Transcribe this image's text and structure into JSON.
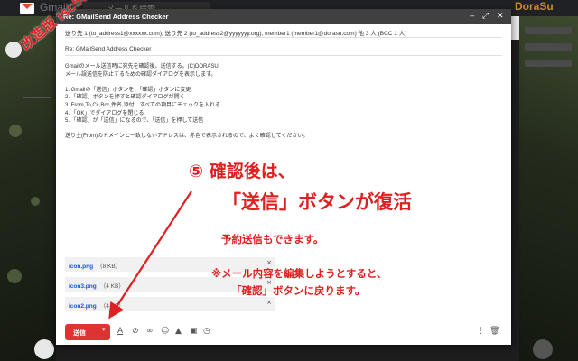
{
  "gmail": {
    "logo_text": "Gmail",
    "search_text": "メールを検索",
    "brand": "DoraSu"
  },
  "window": {
    "title": "Re: GMailSend Address Checker"
  },
  "fields": {
    "to": "送り先 1 (to_address1@xxxxxx.com), 送り先 2 (to_address2@yyyyyyy.org), member1 (member1@dorasu.com) 他 3 人 (BCC 1 人)",
    "subject": "Re: GMailSend Address Checker"
  },
  "body": [
    "Gmailのメール送信時に宛先を確認後、送信する。(C)DORASU",
    "メール誤送信を防止するための確認ダイアログを表示します。",
    "",
    "1. Gmailの「送信」ボタンを、「確認」ボタンに変更",
    "2. 「確認」ボタンを押すと確認ダイアログが開く",
    "3. From,To,Cc,Bcc,件名,添付、すべての項目にチェックを入れる",
    "4. 「OK」でダイアログを閉じる",
    "5. 「確認」が「送信」になるので、「送信」を押して送信",
    "",
    "送り主(From)のドメインと一致しないアドレスは、赤色で表示されるので、よく確認してください。"
  ],
  "attachments": [
    {
      "name": "icon.png",
      "size": "（8 KB）"
    },
    {
      "name": "icon3.png",
      "size": "（4 KB）"
    },
    {
      "name": "icon2.png",
      "size": "（4 KB）"
    }
  ],
  "toolbar": {
    "send_label": "送信"
  },
  "overlay": {
    "watermark": "改造版 tsc566",
    "heading_line1": "⑤ 確認後は、",
    "heading_line2": "「送信」ボタンが復活",
    "subtext": "予約送信もできます。",
    "note_line1": "※メール内容を編集しようとすると、",
    "note_line2": "「確認」ボタンに戻ります。"
  },
  "colors": {
    "annotation": "#e02020",
    "send_button": "#dd3333",
    "title_bar": "#404040",
    "link": "#1558d6"
  },
  "icons": [
    "format-text-icon",
    "attach-icon",
    "link-icon",
    "emoji-icon",
    "drive-icon",
    "image-icon",
    "schedule-icon",
    "more-options-icon",
    "trash-icon"
  ]
}
